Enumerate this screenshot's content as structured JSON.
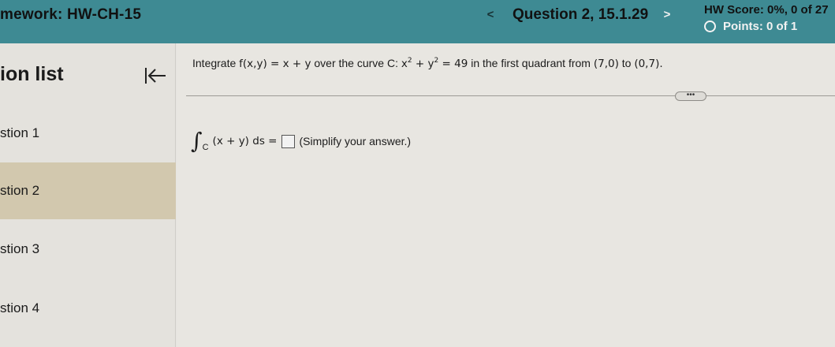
{
  "header": {
    "hw_title": "mework:  HW-CH-15",
    "prev_icon": "<",
    "question_title": "Question 2, 15.1.29",
    "next_icon": ">",
    "hw_score": "HW Score: 0%, 0 of 27",
    "points": "Points: 0 of 1"
  },
  "sidebar": {
    "title": "ion list",
    "collapse_icon": "collapse-left-arrow-icon",
    "items": [
      {
        "label": "stion 1",
        "active": false
      },
      {
        "label": "stion 2",
        "active": true
      },
      {
        "label": "stion 3",
        "active": false
      },
      {
        "label": "stion 4",
        "active": false
      }
    ]
  },
  "question": {
    "prompt_lead": "Integrate",
    "function": "f(x,y) = x + y",
    "prompt_mid": "over the curve C:",
    "curve_lhs_a": "x",
    "curve_exp_a": "2",
    "curve_plus": " + y",
    "curve_exp_b": "2",
    "curve_rhs": " = 49",
    "prompt_tail": "in the first quadrant from",
    "point_from": "(7,0)",
    "prompt_to": "to",
    "point_to": "(0,7).",
    "more_label": "•••",
    "integral_symbol": "∫",
    "integral_sub": "C",
    "integrand": "(x + y) ds =",
    "answer_value": "",
    "hint": "(Simplify your answer.)"
  },
  "colors": {
    "header_bg": "#3e8a93",
    "active_item_bg": "#d2c8ae",
    "page_bg": "#e8e6e1"
  }
}
